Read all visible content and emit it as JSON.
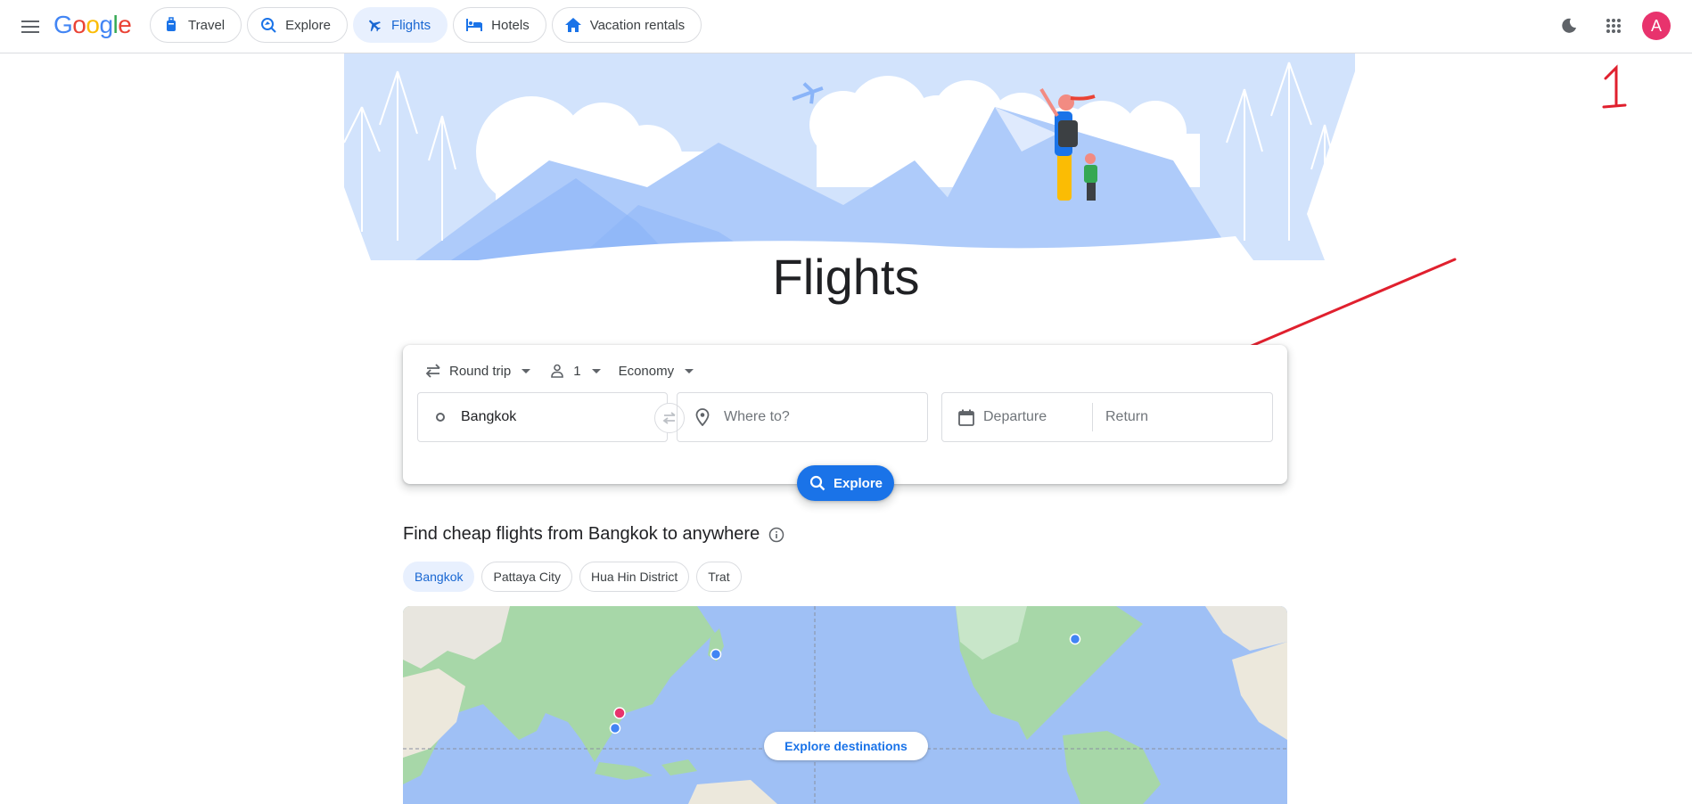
{
  "topbar": {
    "logo": "Google",
    "tabs": [
      {
        "label": "Travel",
        "icon": "travel-icon"
      },
      {
        "label": "Explore",
        "icon": "explore-icon"
      },
      {
        "label": "Flights",
        "icon": "flight-icon",
        "active": true
      },
      {
        "label": "Hotels",
        "icon": "hotel-icon"
      },
      {
        "label": "Vacation rentals",
        "icon": "home-icon"
      }
    ],
    "avatar_letter": "A"
  },
  "hero": {
    "title": "Flights"
  },
  "annotation": {
    "number": "1",
    "color": "#e0202e"
  },
  "search": {
    "trip_type": "Round trip",
    "passengers": "1",
    "cabin_class": "Economy",
    "from_value": "Bangkok",
    "to_placeholder": "Where to?",
    "departure_placeholder": "Departure",
    "return_placeholder": "Return",
    "explore_button": "Explore"
  },
  "cheap_flights": {
    "title": "Find cheap flights from Bangkok to anywhere",
    "chips": [
      "Bangkok",
      "Pattaya City",
      "Hua Hin District",
      "Trat"
    ],
    "active_chip": "Bangkok",
    "map_button": "Explore destinations"
  },
  "colors": {
    "accent": "#1a73e8",
    "active_bg": "#e8f0fe",
    "avatar": "#e8336d",
    "ocean": "#9fc0f5"
  }
}
